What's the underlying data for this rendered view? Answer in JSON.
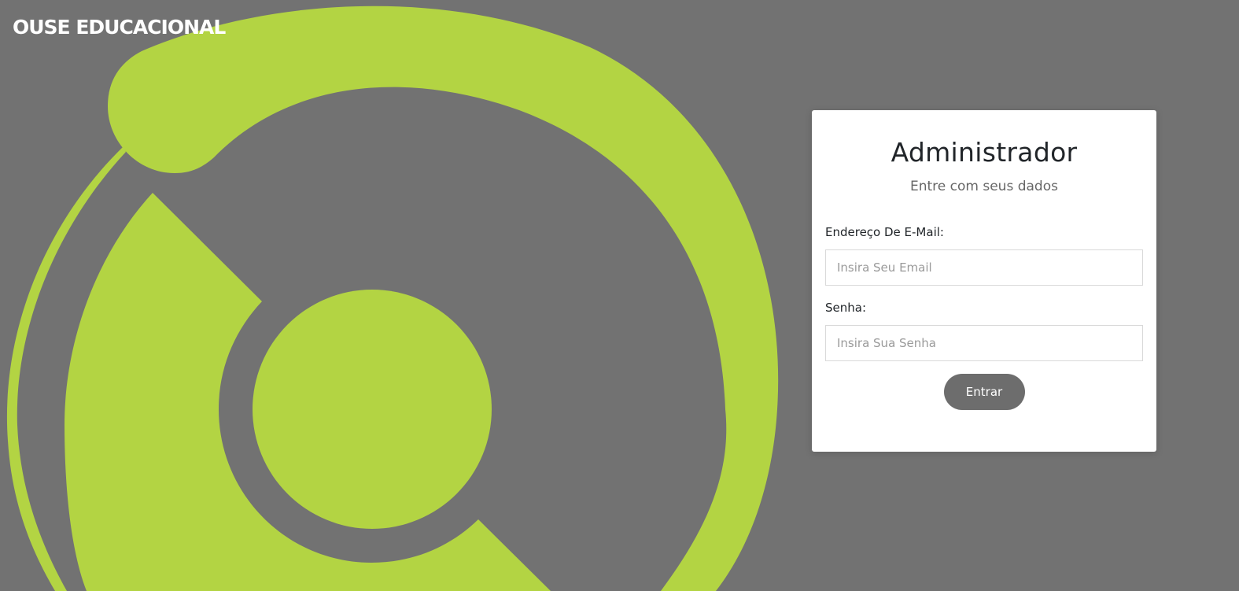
{
  "brand": {
    "name": "OUSE EDUCACIONAL"
  },
  "login": {
    "title": "Administrador",
    "subtitle": "Entre com seus dados",
    "email_label": "Endereço De E-Mail:",
    "email_placeholder": "Insira Seu Email",
    "email_value": "",
    "password_label": "Senha:",
    "password_placeholder": "Insira Sua Senha",
    "password_value": "",
    "submit_label": "Entrar"
  },
  "colors": {
    "background": "#727272",
    "accent": "#b3d443",
    "card": "#ffffff",
    "button": "#6d6d6d"
  },
  "icons": {
    "background_graphic": "brand-logo-graphic"
  }
}
